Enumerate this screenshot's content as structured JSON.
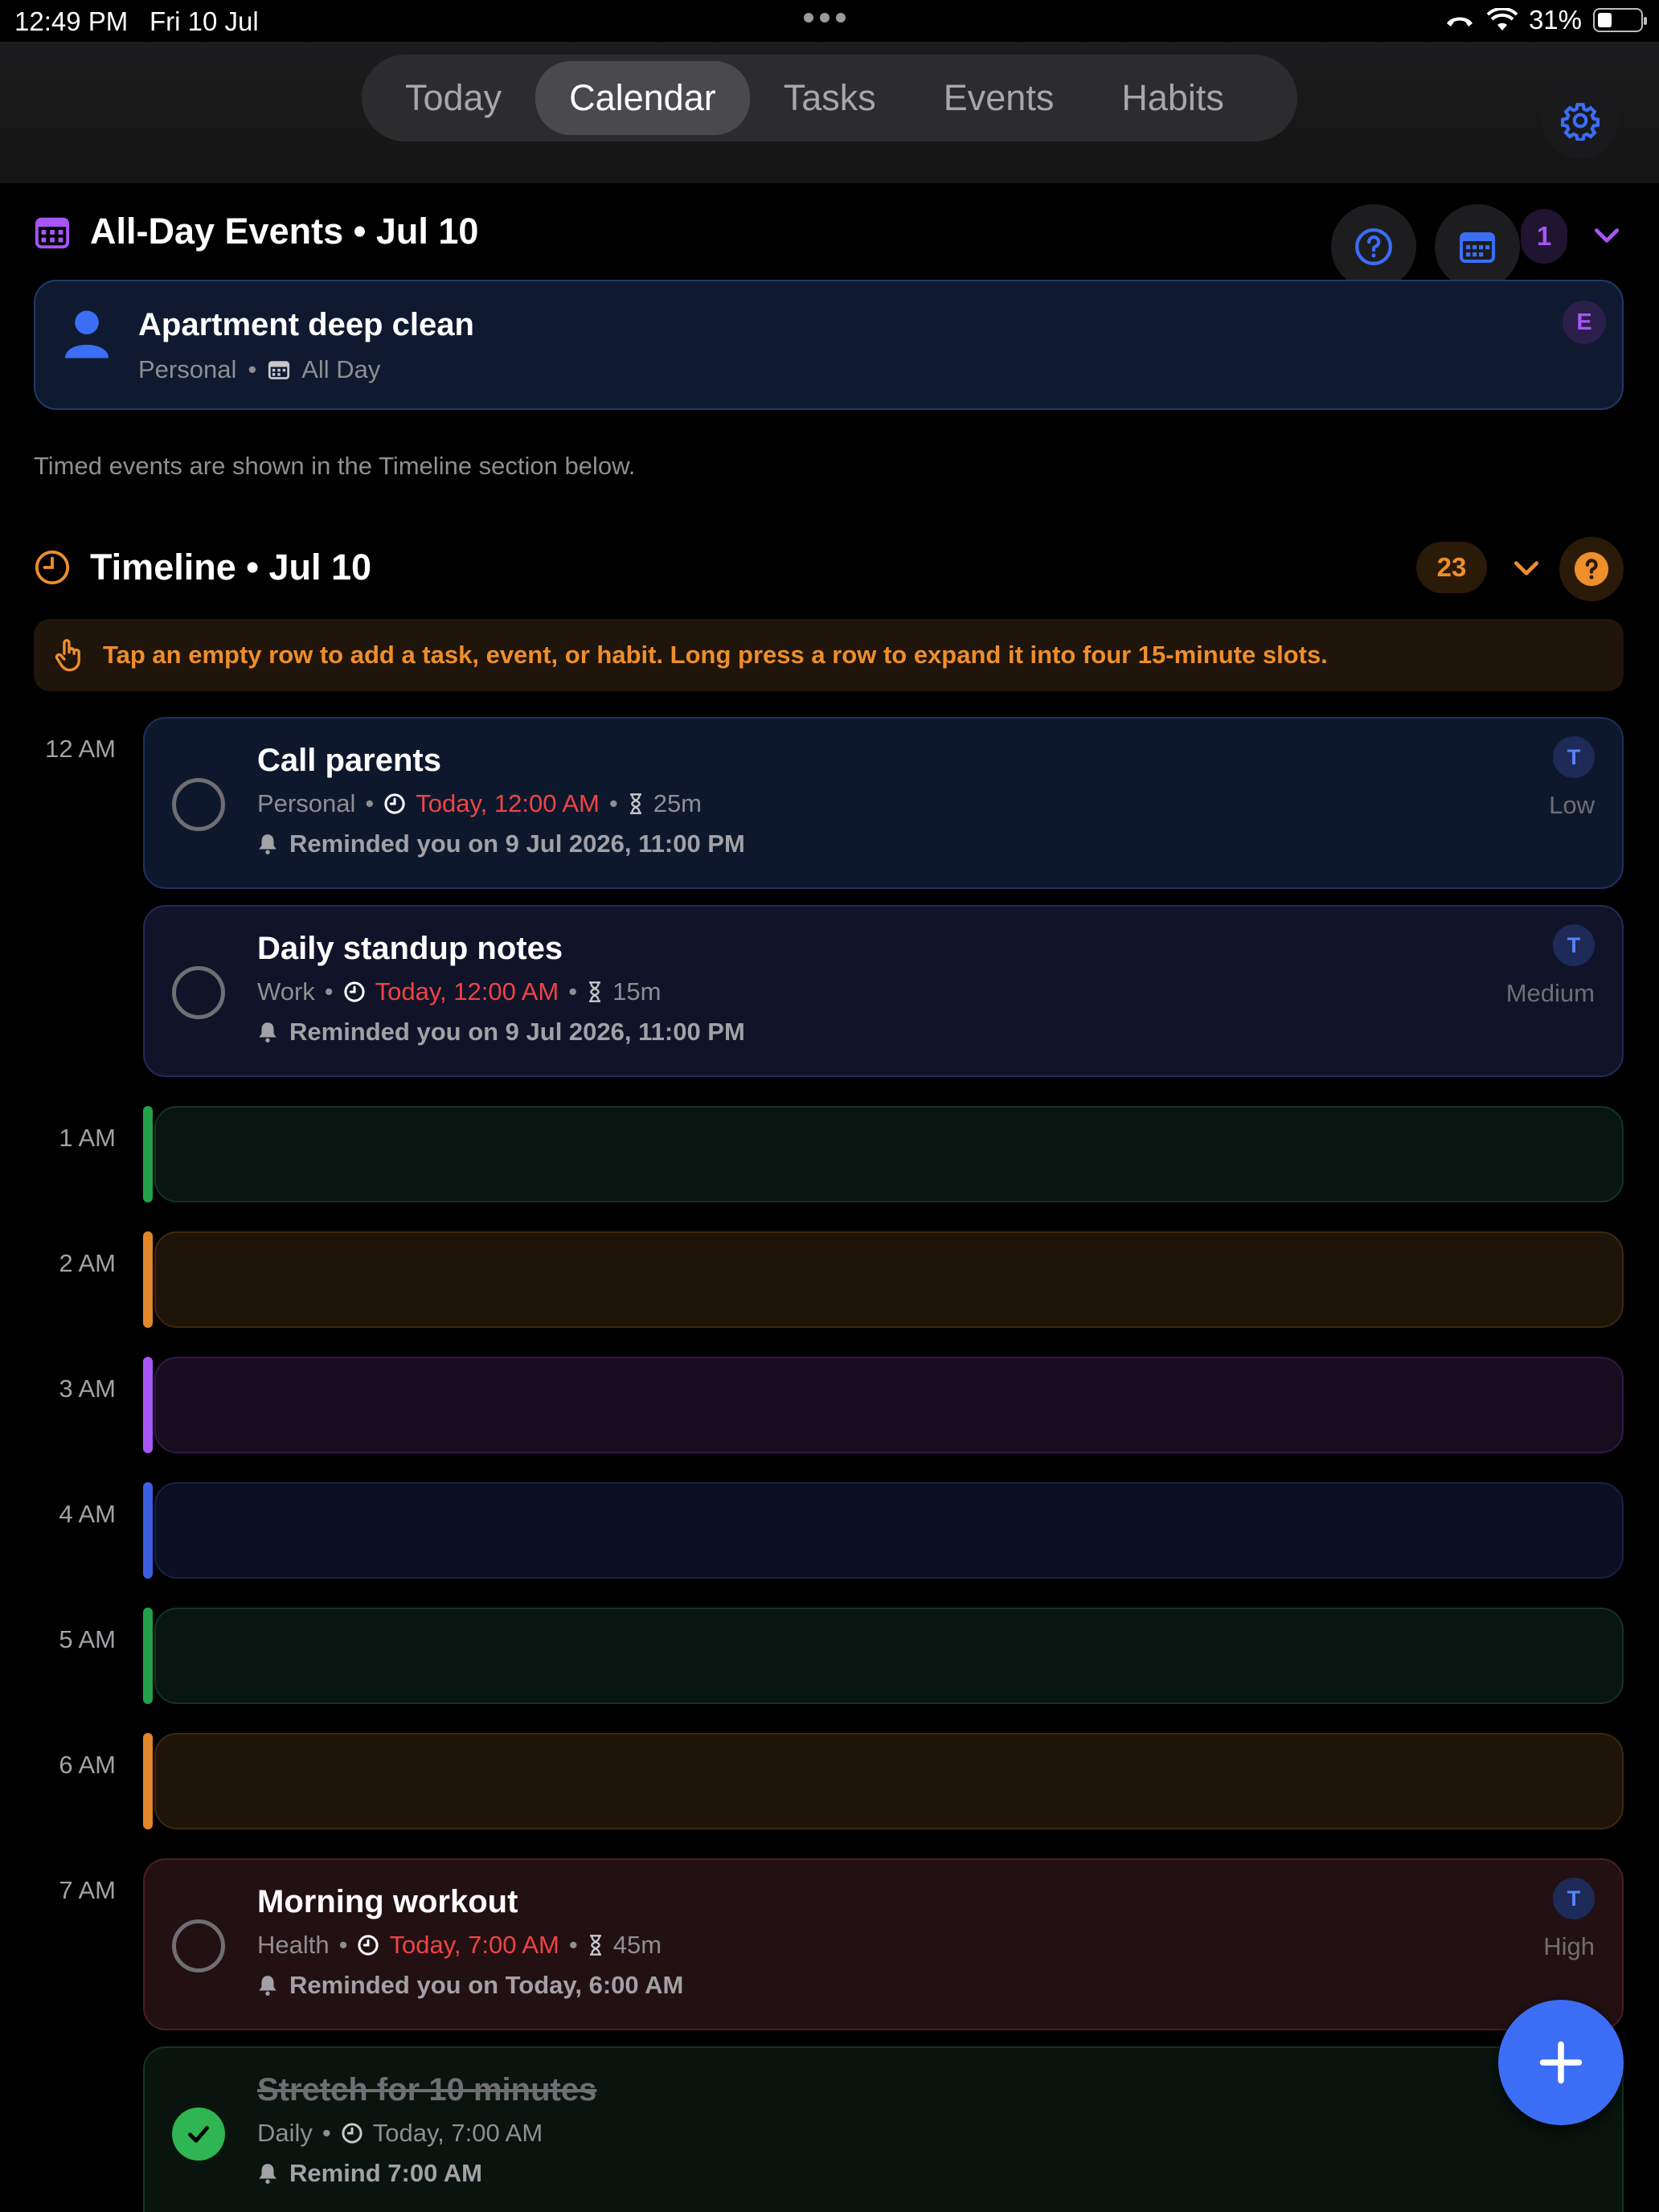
{
  "status_bar": {
    "time": "12:49 PM",
    "date": "Fri 10 Jul",
    "battery": "31%",
    "battery_level": 0.31
  },
  "nav": {
    "tabs": [
      {
        "label": "Today"
      },
      {
        "label": "Calendar",
        "active": true
      },
      {
        "label": "Tasks"
      },
      {
        "label": "Events"
      },
      {
        "label": "Habits"
      }
    ]
  },
  "all_day": {
    "title": "All-Day Events • Jul 10",
    "count": "1",
    "event": {
      "title": "Apartment deep clean",
      "category": "Personal",
      "when": "All Day",
      "badge": "E"
    },
    "note": "Timed events are shown in the Timeline section below."
  },
  "timeline": {
    "title": "Timeline • Jul 10",
    "count": "23",
    "hint": "Tap an empty row to add a task, event, or habit. Long press a row to expand it into four 15-minute slots.",
    "hours": {
      "h12": "12 AM",
      "h1": "1 AM",
      "h2": "2 AM",
      "h3": "3 AM",
      "h4": "4 AM",
      "h5": "5 AM",
      "h6": "6 AM",
      "h7": "7 AM"
    },
    "tasks": {
      "call_parents": {
        "title": "Call parents",
        "category": "Personal",
        "time": "Today, 12:00 AM",
        "duration": "25m",
        "reminder": "Reminded you on 9 Jul 2026, 11:00 PM",
        "priority": "Low",
        "badge": "T"
      },
      "standup": {
        "title": "Daily standup notes",
        "category": "Work",
        "time": "Today, 12:00 AM",
        "duration": "15m",
        "reminder": "Reminded you on 9 Jul 2026, 11:00 PM",
        "priority": "Medium",
        "badge": "T"
      },
      "workout": {
        "title": "Morning workout",
        "category": "Health",
        "time": "Today, 7:00 AM",
        "duration": "45m",
        "reminder": "Reminded you on Today, 6:00 AM",
        "priority": "High",
        "badge": "T"
      },
      "stretch": {
        "title": "Stretch for 10 minutes",
        "category": "Daily",
        "time": "Today, 7:00 AM",
        "reminder": "Remind 7:00 AM",
        "done": true
      }
    }
  },
  "colors": {
    "accent_blue": "#3b6ef5",
    "accent_orange": "#ee8e2c",
    "accent_purple": "#a855f7",
    "overdue_red": "#ef4444",
    "done_green": "#2fb552"
  },
  "icons": [
    "calendar-icon",
    "gear-icon",
    "help-icon",
    "calendar-grid-icon",
    "chevron-down-icon",
    "person-icon",
    "clock-icon",
    "hourglass-icon",
    "bell-icon",
    "hand-tap-icon",
    "check-icon",
    "plus-icon"
  ]
}
